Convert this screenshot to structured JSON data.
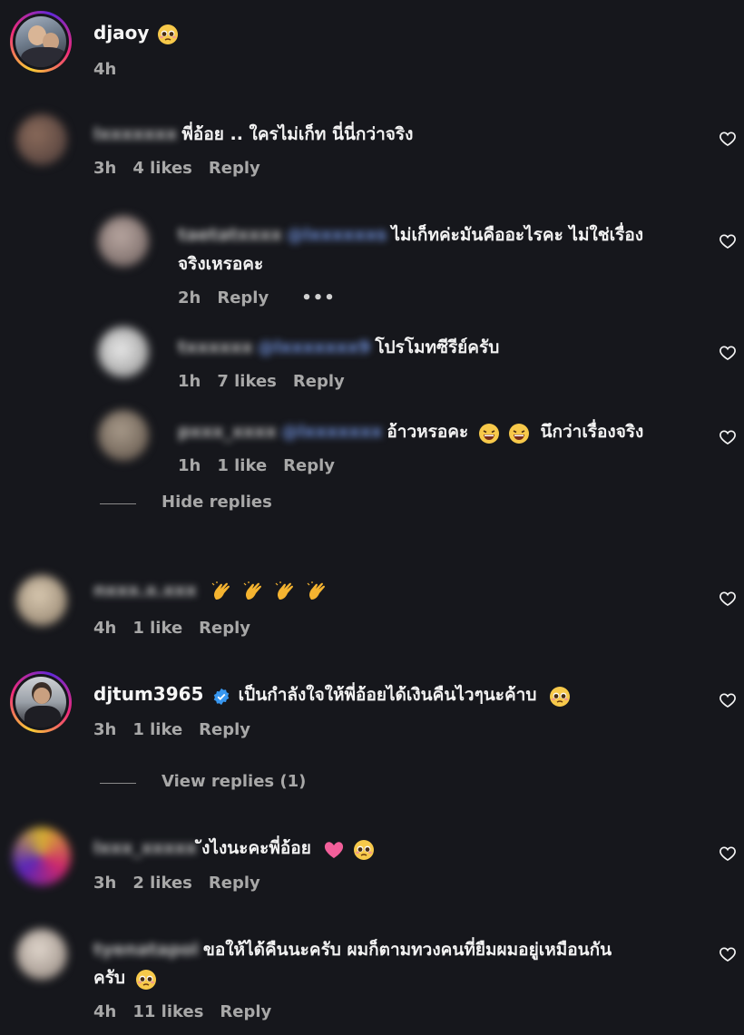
{
  "post": {
    "username": "djaoy",
    "time": "4h"
  },
  "comments": [
    {
      "blur_name": "lxxxxxxx",
      "text": "พี่อ้อย .. ใครไม่เก็ท นี่นี่กว่าจริง",
      "time": "3h",
      "likes": "4 likes",
      "reply": "Reply"
    },
    {
      "blur_name": "taetatxxxx",
      "blur_mention": "@lxxxxxxs",
      "text_line1": "ไม่เก็ทค่ะมันคืออะไรคะ ไม่ใช่เรื่อง",
      "text_line2": "จริงเหรอคะ",
      "time": "2h",
      "reply": "Reply",
      "more": "•••"
    },
    {
      "blur_name": "txxxxxx",
      "blur_mention": "@lxxxxxxx9",
      "text": "โปรโมทซีรีย์ครับ",
      "time": "1h",
      "likes": "7 likes",
      "reply": "Reply"
    },
    {
      "blur_name": "pxxx_xxxx",
      "blur_mention": "@lxxxxxxx",
      "text": "อ้าวหรอคะ",
      "text_after": "นึกว่าเรื่องจริง",
      "time": "1h",
      "likes": "1 like",
      "reply": "Reply"
    },
    {
      "hide_replies": "Hide replies"
    },
    {
      "blur_name": "nxxx.x.xxx",
      "time": "4h",
      "likes": "1 like",
      "reply": "Reply"
    },
    {
      "username": "djtum3965",
      "text": "เป็นกำลังใจให้พี่อ้อยได้เงินคืนไวๆนะค้าบ",
      "time": "3h",
      "likes": "1 like",
      "reply": "Reply",
      "view_replies": "View replies (1)"
    },
    {
      "blur_name": "lxxx_xxxxx",
      "text": "ังไงนะคะพี่อ้อย",
      "time": "3h",
      "likes": "2 likes",
      "reply": "Reply"
    },
    {
      "blur_name": "tyenatapol",
      "text_line1": "ขอให้ได้คืนนะครับ ผมก็ตามทวงคนที่ยืมผมอยู่เหมือนกัน",
      "text_line2": "ครับ",
      "time": "4h",
      "likes": "11 likes",
      "reply": "Reply"
    }
  ],
  "icons": {
    "heart": "heart-outline-icon",
    "verified": "verified-badge-icon",
    "pleading": "pleading-face-emoji",
    "laugh": "laughing-emoji",
    "clap": "clapping-hands-emoji",
    "pink_heart": "pink-heart-emoji"
  },
  "colors": {
    "background": "#16171c",
    "meta": "#a8a8a8",
    "verified": "#3897f0"
  }
}
